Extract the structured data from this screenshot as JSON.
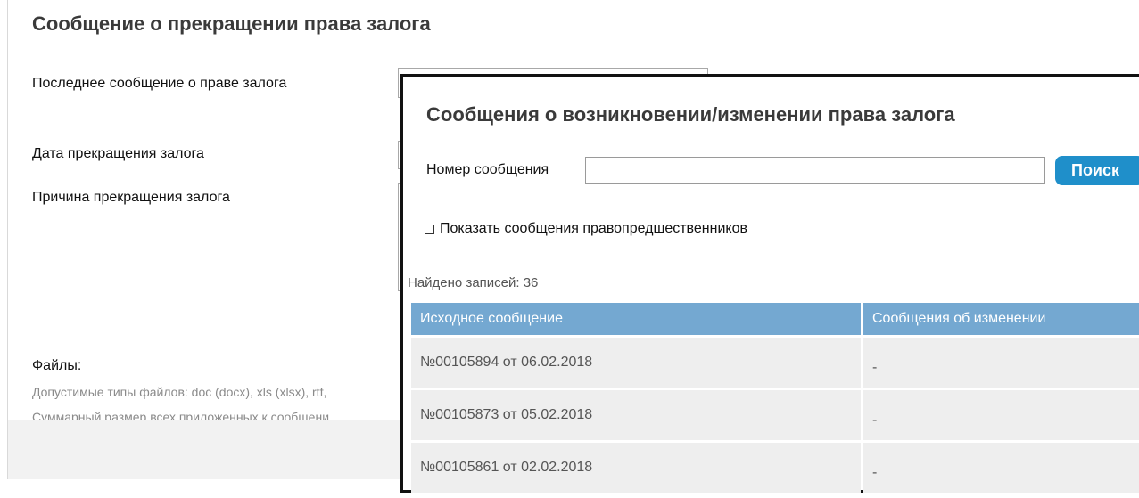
{
  "background_form": {
    "title": "Сообщение о прекращении права залога",
    "last_message_label": "Последнее сообщение о праве залога",
    "termination_date_label": "Дата прекращения залога",
    "termination_reason_label": "Причина прекращения залога",
    "files_label": "Файлы:",
    "file_types_hint": "Допустимые типы файлов: doc (docx), xls (xlsx), rtf,",
    "file_size_hint": "Суммарный размер всех приложенных к сообщени"
  },
  "modal": {
    "title": "Сообщения о возникновении/изменении права залога",
    "search": {
      "label": "Номер сообщения",
      "value": "",
      "button_label": "Поиск"
    },
    "show_predecessors_label": "Показать сообщения правопредшественников",
    "show_predecessors_checked": false,
    "found_text": "Найдено записей: 36",
    "table": {
      "columns": [
        "Исходное сообщение",
        "Сообщения об изменении"
      ],
      "rows": [
        {
          "original": "№00105894 от 06.02.2018",
          "changes": "-"
        },
        {
          "original": "№00105873 от 05.02.2018",
          "changes": "-"
        },
        {
          "original": "№00105861 от 02.02.2018",
          "changes": "-"
        }
      ]
    }
  },
  "colors": {
    "accent_button": "#1f8fca",
    "table_header": "#74a8d1",
    "row_background": "#eeeeee"
  }
}
